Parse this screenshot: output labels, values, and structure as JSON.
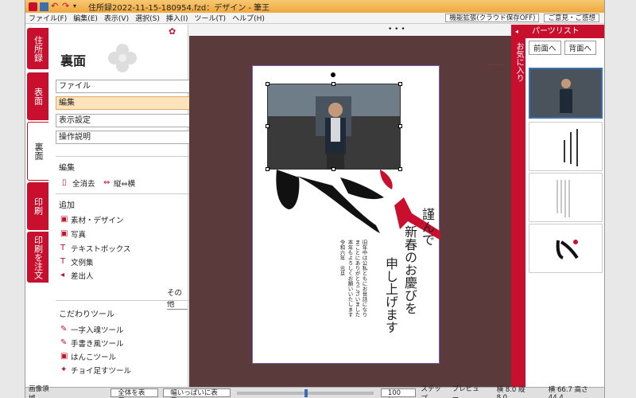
{
  "window": {
    "title": "住所録2022-11-15-180954.fzd：デザイン - 筆王"
  },
  "menu": {
    "items": [
      "ファイル(F)",
      "編集(E)",
      "表示(V)",
      "選択(S)",
      "挿入(I)",
      "ツール(T)",
      "ヘルプ(H)"
    ],
    "feature_btn": "機能拡張(クラウド保存OFF)",
    "feedback_btn": "ご意見・ご感想"
  },
  "lefttabs": [
    "住所録",
    "表面",
    "裏面",
    "印刷",
    "印刷を注文"
  ],
  "panel": {
    "title": "裏面",
    "menu_file": "ファイル",
    "menu_edit": "編集",
    "menu_view": "表示設定",
    "menu_help": "操作説明",
    "edit_section": "編集",
    "delete_all": "全消去",
    "rotate": "縦⇔横",
    "add_section": "追加",
    "add_items": [
      "素材・デザイン",
      "写真",
      "テキストボックス",
      "文例集",
      "差出人"
    ],
    "more": "その他",
    "kodawari_section": "こだわりツール",
    "kodawari_items": [
      "一字入魂ツール",
      "手書き風ツール",
      "はんこツール",
      "チョイ足すツール"
    ]
  },
  "canvas": {
    "greeting_lines": [
      "謹んで",
      "新春のお慶びを",
      "申し上げます"
    ],
    "body_lines": [
      "旧年中は公私ともにお世話になり",
      "まことにありがとうございました",
      "本年もよろしくお願いいたします",
      "令和六年　元旦"
    ],
    "kanji": "辰",
    "red_color": "#c8102e"
  },
  "right": {
    "fav_label": "お気に入り",
    "parts_list": "パーツリスト",
    "front_btn": "前面へ",
    "back_btn": "背面へ"
  },
  "status": {
    "area": "画像領域",
    "fit_all": "全体を表示",
    "fit_width": "幅いっぱいに表示",
    "zoom": "100 %",
    "step": "ステップ",
    "preview": "プレビュー",
    "size": "横 8.0 縦 8.0",
    "position": "横 66.7 高さ 44.4"
  }
}
